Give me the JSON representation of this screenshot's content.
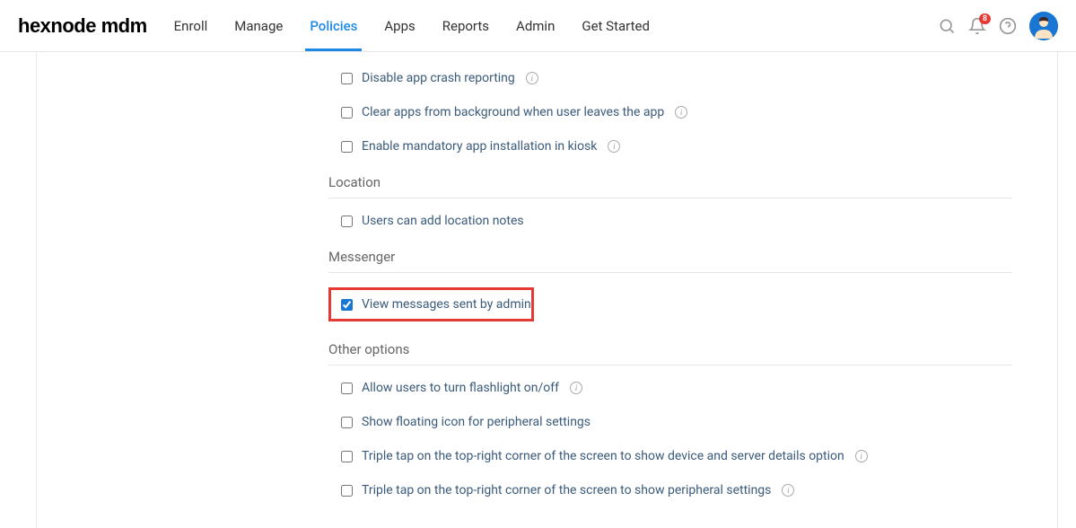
{
  "header": {
    "logo": "hexnode mdm",
    "nav": {
      "enroll": "Enroll",
      "manage": "Manage",
      "policies": "Policies",
      "apps": "Apps",
      "reports": "Reports",
      "admin": "Admin",
      "get_started": "Get Started"
    },
    "notification_count": "8"
  },
  "sections": {
    "top_items": {
      "disable_crash": "Disable app crash reporting",
      "clear_apps": "Clear apps from background when user leaves the app",
      "enable_mandatory": "Enable mandatory app installation in kiosk"
    },
    "location": {
      "title": "Location",
      "location_notes": "Users can add location notes"
    },
    "messenger": {
      "title": "Messenger",
      "view_messages": "View messages sent by admin"
    },
    "other_options": {
      "title": "Other options",
      "flashlight": "Allow users to turn flashlight on/off",
      "floating_icon": "Show floating icon for peripheral settings",
      "triple_tap_device": "Triple tap on the top-right corner of the screen to show device and server details option",
      "triple_tap_peripheral": "Triple tap on the top-right corner of the screen to show peripheral settings"
    }
  }
}
